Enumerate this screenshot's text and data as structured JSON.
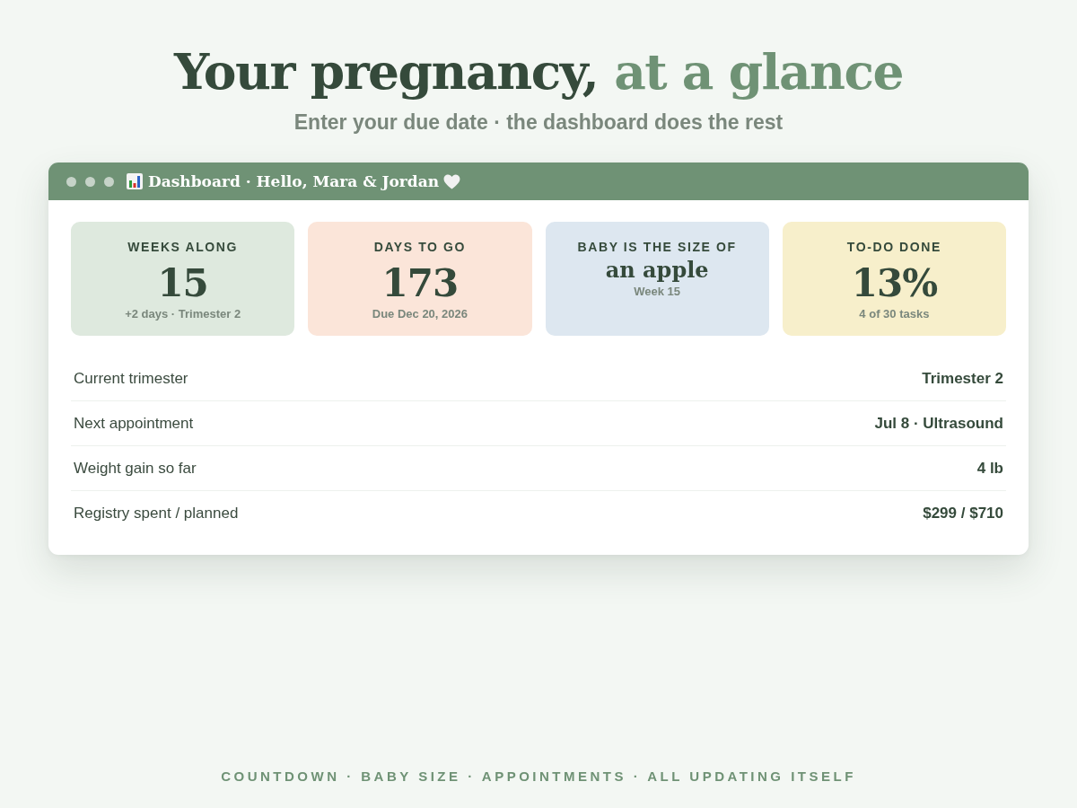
{
  "header": {
    "title_lead": "Your pregnancy,",
    "title_accent": "at a glance",
    "subtitle": "Enter your due date · the dashboard does the rest"
  },
  "window": {
    "title": "Dashboard · Hello, Mara & Jordan"
  },
  "cards": [
    {
      "kind": "number",
      "label": "WEEKS ALONG",
      "value": "15",
      "note": "+2 days · Trimester 2",
      "color": "#dee9de"
    },
    {
      "kind": "number",
      "label": "DAYS TO GO",
      "value": "173",
      "note": "Due Dec 20, 2026",
      "color": "#fbe5d9"
    },
    {
      "kind": "phrase",
      "label": "BABY IS THE SIZE OF",
      "value": "an apple",
      "note": "Week 15",
      "color": "#dde7f0"
    },
    {
      "kind": "number",
      "label": "TO-DO DONE",
      "value": "13%",
      "note": "4 of 30 tasks",
      "color": "#f7efcb"
    }
  ],
  "rows": [
    {
      "label": "Current trimester",
      "value": "Trimester 2"
    },
    {
      "label": "Next appointment",
      "value": "Jul 8 · Ultrasound"
    },
    {
      "label": "Weight gain so far",
      "value": "4 lb"
    },
    {
      "label": "Registry spent / planned",
      "value": "$299 / $710"
    }
  ],
  "footer": "COUNTDOWN · BABY SIZE · APPOINTMENTS · ALL UPDATING ITSELF"
}
